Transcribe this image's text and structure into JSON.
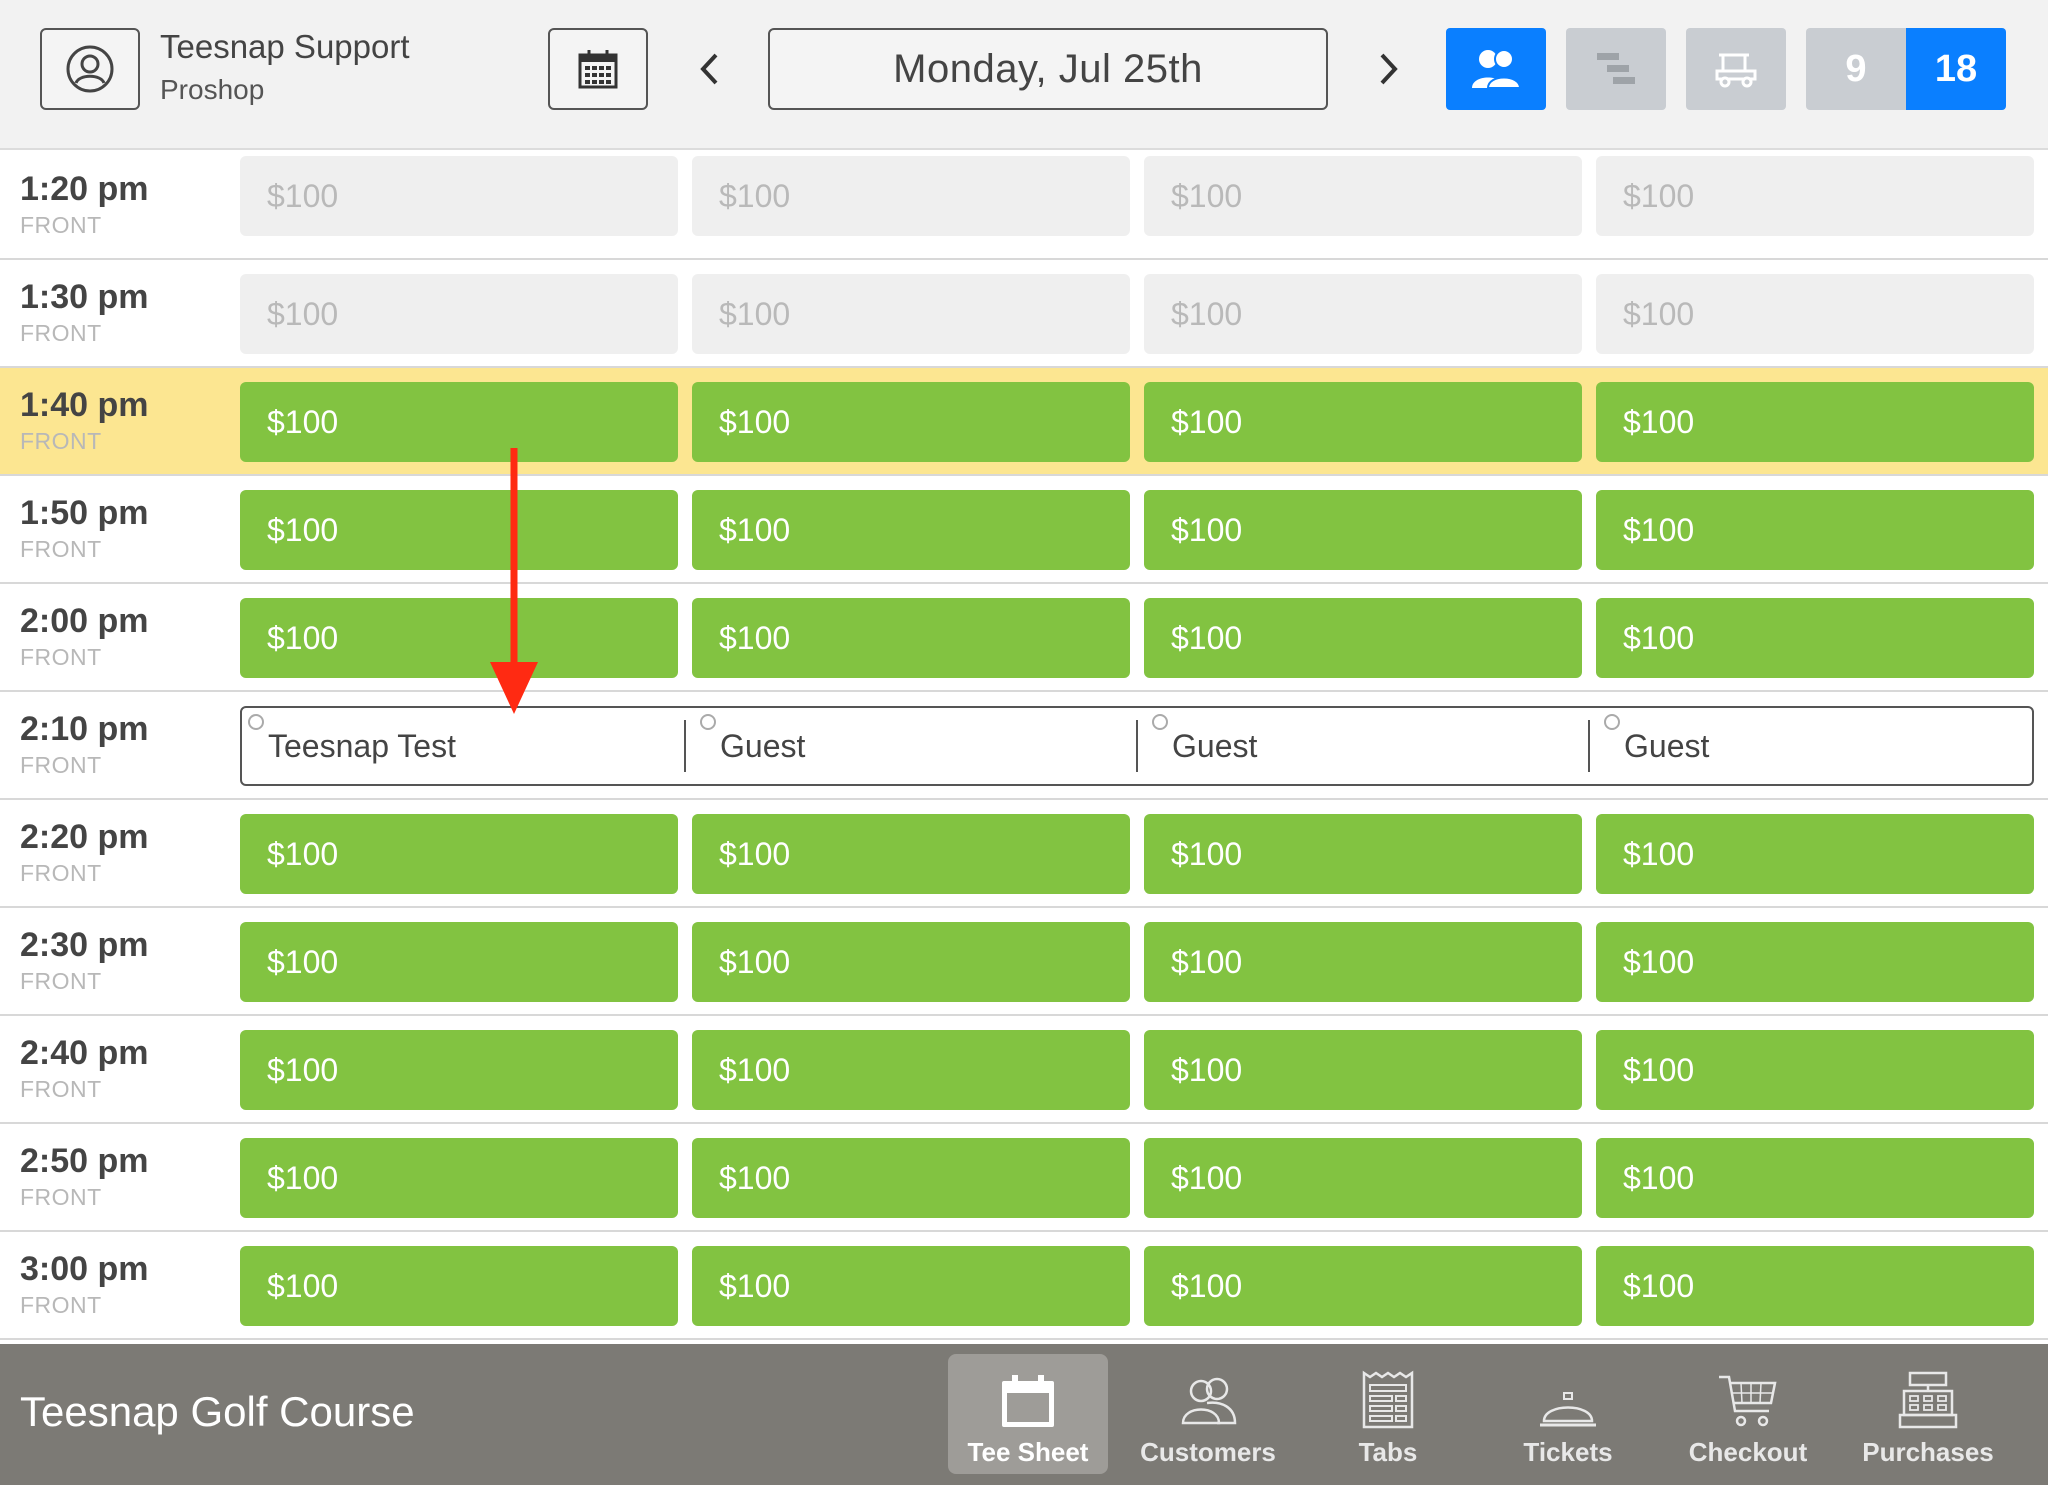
{
  "header": {
    "user_name": "Teesnap Support",
    "user_role": "Proshop",
    "date": "Monday, Jul 25th",
    "holes": {
      "nine": "9",
      "eighteen": "18",
      "selected": "18"
    }
  },
  "colors": {
    "accent": "#0a7fff",
    "open_slot": "#82c341",
    "current_row": "#fce691",
    "annotation": "#ff2a12",
    "footer": "#7c7a75"
  },
  "tee_times": [
    {
      "time": "1:20 pm",
      "side": "FRONT",
      "status": "past",
      "slots": [
        "$100",
        "$100",
        "$100",
        "$100"
      ]
    },
    {
      "time": "1:30 pm",
      "side": "FRONT",
      "status": "past",
      "slots": [
        "$100",
        "$100",
        "$100",
        "$100"
      ]
    },
    {
      "time": "1:40 pm",
      "side": "FRONT",
      "status": "current",
      "slots": [
        "$100",
        "$100",
        "$100",
        "$100"
      ]
    },
    {
      "time": "1:50 pm",
      "side": "FRONT",
      "status": "open",
      "slots": [
        "$100",
        "$100",
        "$100",
        "$100"
      ]
    },
    {
      "time": "2:00 pm",
      "side": "FRONT",
      "status": "open",
      "slots": [
        "$100",
        "$100",
        "$100",
        "$100"
      ]
    },
    {
      "time": "2:10 pm",
      "side": "FRONT",
      "status": "booked",
      "players": [
        "Teesnap Test",
        "Guest",
        "Guest",
        "Guest"
      ]
    },
    {
      "time": "2:20 pm",
      "side": "FRONT",
      "status": "open",
      "slots": [
        "$100",
        "$100",
        "$100",
        "$100"
      ]
    },
    {
      "time": "2:30 pm",
      "side": "FRONT",
      "status": "open",
      "slots": [
        "$100",
        "$100",
        "$100",
        "$100"
      ]
    },
    {
      "time": "2:40 pm",
      "side": "FRONT",
      "status": "open",
      "slots": [
        "$100",
        "$100",
        "$100",
        "$100"
      ]
    },
    {
      "time": "2:50 pm",
      "side": "FRONT",
      "status": "open",
      "slots": [
        "$100",
        "$100",
        "$100",
        "$100"
      ]
    },
    {
      "time": "3:00 pm",
      "side": "FRONT",
      "status": "open",
      "slots": [
        "$100",
        "$100",
        "$100",
        "$100"
      ]
    }
  ],
  "footer": {
    "course_name": "Teesnap Golf Course",
    "tabs": [
      {
        "label": "Tee Sheet",
        "icon": "calendar-icon",
        "active": true
      },
      {
        "label": "Customers",
        "icon": "customers-icon",
        "active": false
      },
      {
        "label": "Tabs",
        "icon": "receipt-icon",
        "active": false
      },
      {
        "label": "Tickets",
        "icon": "service-bell-icon",
        "active": false
      },
      {
        "label": "Checkout",
        "icon": "cart-icon",
        "active": false
      },
      {
        "label": "Purchases",
        "icon": "register-icon",
        "active": false
      }
    ]
  }
}
